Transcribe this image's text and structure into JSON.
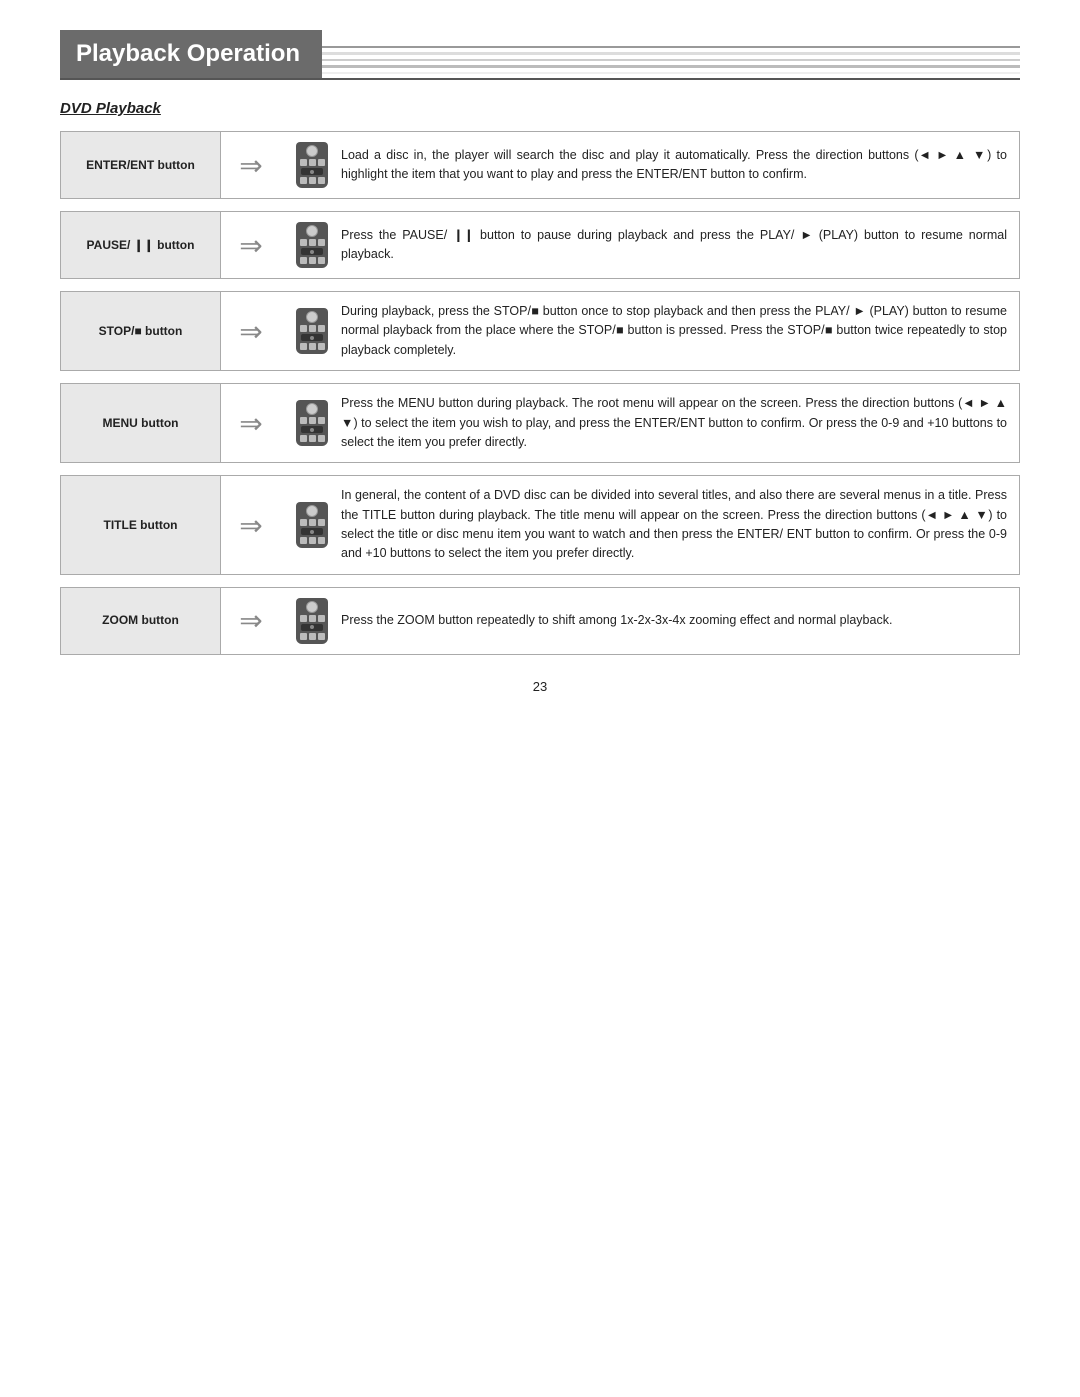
{
  "header": {
    "title": "Playback Operation",
    "subtitle": "DVD Playback"
  },
  "operations": [
    {
      "id": "enter-ent",
      "label": "ENTER/ENT\nbutton",
      "text": "Load a disc in, the player will search the disc and play it automatically. Press the direction buttons (◄ ► ▲ ▼) to highlight the item that you want to play and press the ENTER/ENT button to confirm."
    },
    {
      "id": "pause",
      "label": "PAUSE/ ❙❙\nbutton",
      "text": "Press the PAUSE/ ❙❙ button to pause during playback and press the PLAY/ ► (PLAY) button to resume normal playback."
    },
    {
      "id": "stop",
      "label": "STOP/■ button",
      "text": "During playback, press the STOP/■ button once to stop playback and then press the PLAY/ ► (PLAY) button to resume normal playback from the place where the STOP/■ button is pressed. Press the STOP/■ button twice repeatedly to stop playback completely."
    },
    {
      "id": "menu",
      "label": "MENU button",
      "text": "Press the MENU button during playback. The root menu will appear on the screen.\nPress the direction buttons (◄ ► ▲ ▼) to select the item you wish to play, and press the ENTER/ENT button to confirm. Or press the 0-9 and +10 buttons to select the item you prefer directly."
    },
    {
      "id": "title",
      "label": "TITLE button",
      "text": "In general, the content of a DVD disc can be divided into several titles, and also there are several menus in a title. Press the TITLE button during playback. The title menu will appear on the screen. Press the direction buttons (◄ ► ▲ ▼) to select the title or disc menu item you want to watch and then press the ENTER/ ENT button to confirm. Or press the 0-9 and +10 buttons to select the item you prefer directly."
    },
    {
      "id": "zoom",
      "label": "ZOOM button",
      "text": "Press the ZOOM button repeatedly to shift among 1x-2x-3x-4x zooming effect and normal playback."
    }
  ],
  "page_number": "23"
}
